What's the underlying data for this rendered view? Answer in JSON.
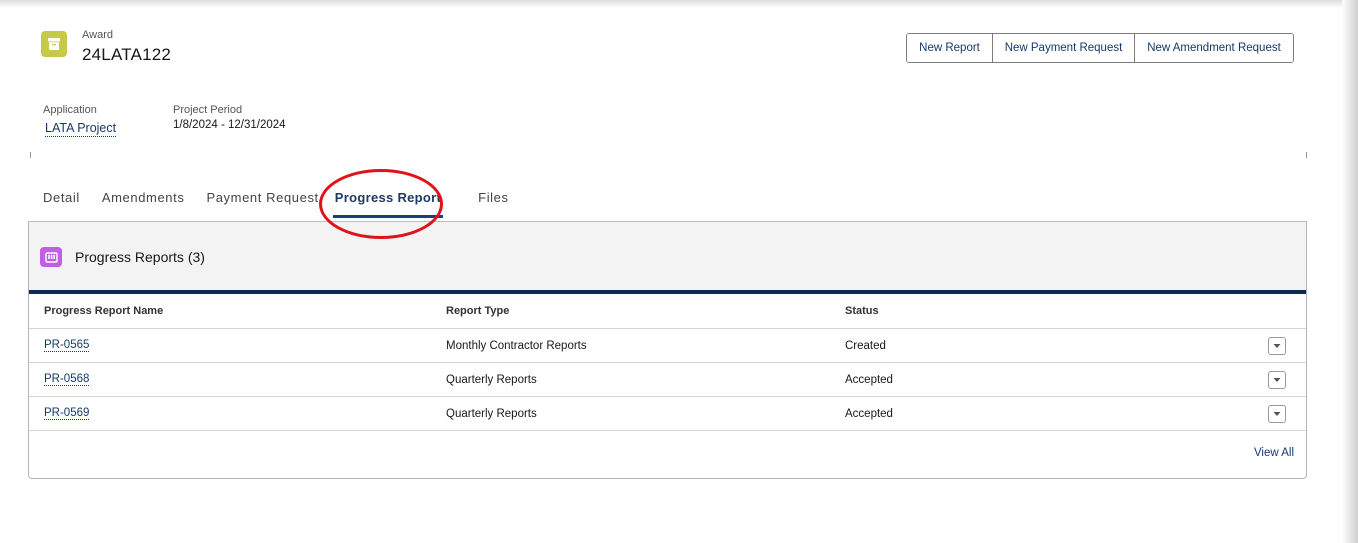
{
  "record": {
    "type_label": "Award",
    "title": "24LATA122",
    "icon": "archive-box-icon",
    "icon_color": "#c6c94a"
  },
  "actions": {
    "new_report": "New Report",
    "new_payment_request": "New Payment Request",
    "new_amendment_request": "New Amendment Request"
  },
  "highlights": {
    "application_label": "Application",
    "application_value": "LATA Project",
    "project_period_label": "Project Period",
    "project_period_value": "1/8/2024 - 12/31/2024"
  },
  "tabs": [
    {
      "label": "Detail",
      "active": false
    },
    {
      "label": "Amendments",
      "active": false
    },
    {
      "label": "Payment Request",
      "active": false
    },
    {
      "label": "Progress Report",
      "active": true
    },
    {
      "label": "Files",
      "active": false
    }
  ],
  "related_list": {
    "title": "Progress Reports (3)",
    "icon": "progress-report-icon",
    "icon_color": "#c15ee6",
    "accent_color": "#0e2a4d",
    "columns": [
      "Progress Report Name",
      "Report Type",
      "Status"
    ],
    "rows": [
      {
        "name": "PR-0565",
        "type": "Monthly Contractor Reports",
        "status": "Created"
      },
      {
        "name": "PR-0568",
        "type": "Quarterly Reports",
        "status": "Accepted"
      },
      {
        "name": "PR-0569",
        "type": "Quarterly Reports",
        "status": "Accepted"
      }
    ],
    "view_all": "View All"
  },
  "annotation": {
    "color": "#e0121a",
    "target": "Progress Report"
  },
  "colors": {
    "link": "#143a6b",
    "active_tab_underline": "#1b3f78"
  }
}
